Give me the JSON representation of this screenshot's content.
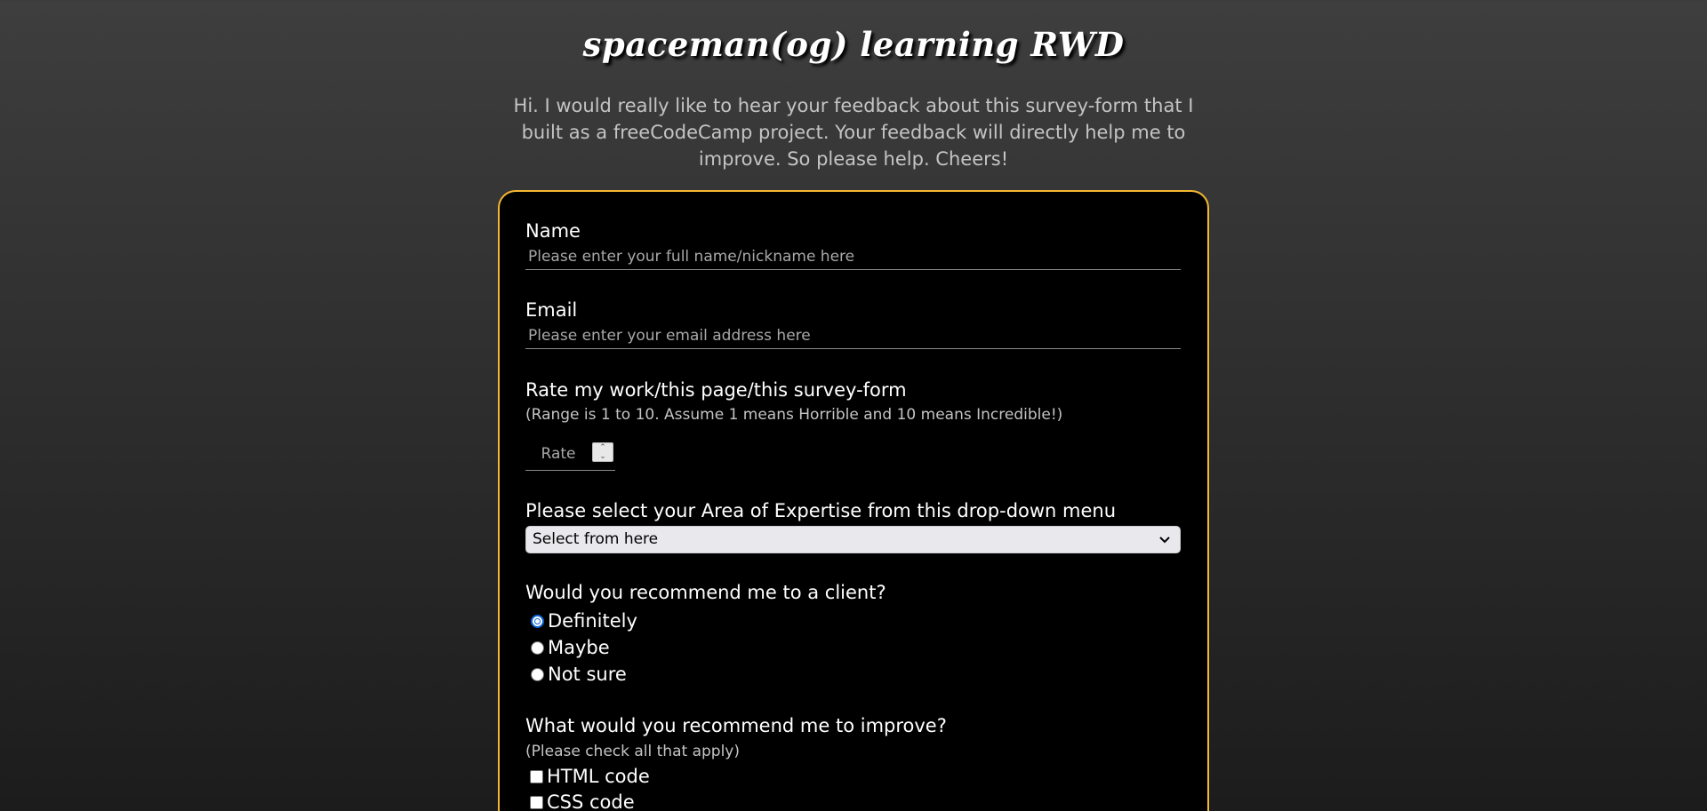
{
  "header": {
    "title": "spaceman(og) learning RWD",
    "intro": "Hi. I would really like to hear your feedback about this survey-form that I built as a freeCodeCamp project. Your feedback will directly help me to improve. So please help. Cheers!"
  },
  "colors": {
    "accent_border": "#f5b731",
    "card_background": "#000000",
    "radio_selected": "#0a63d8"
  },
  "form": {
    "name": {
      "label": "Name",
      "placeholder": "Please enter your full name/nickname here",
      "value": ""
    },
    "email": {
      "label": "Email",
      "placeholder": "Please enter your email address here",
      "value": ""
    },
    "rating": {
      "label": "Rate my work/this page/this survey-form",
      "hint": "(Range is 1 to 10. Assume 1 means Horrible and 10 means Incredible!)",
      "placeholder": "Rate",
      "value": ""
    },
    "expertise": {
      "label": "Please select your Area of Expertise from this drop-down menu",
      "selected": "Select from here"
    },
    "recommend": {
      "label": "Would you recommend me to a client?",
      "options": [
        {
          "label": "Definitely",
          "checked": true
        },
        {
          "label": "Maybe",
          "checked": false
        },
        {
          "label": "Not sure",
          "checked": false
        }
      ]
    },
    "improve": {
      "label": "What would you recommend me to improve?",
      "hint": "(Please check all that apply)",
      "options": [
        {
          "label": "HTML code",
          "checked": false
        },
        {
          "label": "CSS code",
          "checked": false
        }
      ]
    }
  }
}
